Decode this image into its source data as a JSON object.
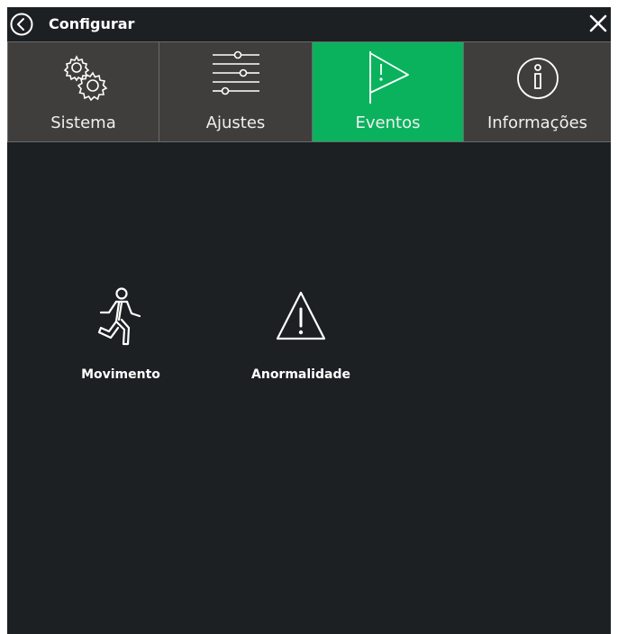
{
  "window": {
    "title": "Configurar",
    "back_icon": "chevron-left-circle-icon",
    "close_icon": "close-icon"
  },
  "tabs": [
    {
      "label": "Sistema",
      "icon": "gears-icon",
      "active": false
    },
    {
      "label": "Ajustes",
      "icon": "sliders-icon",
      "active": false
    },
    {
      "label": "Eventos",
      "icon": "flag-alert-icon",
      "active": true
    },
    {
      "label": "Informações",
      "icon": "info-icon",
      "active": false
    }
  ],
  "events": [
    {
      "label": "Movimento",
      "icon": "running-person-icon"
    },
    {
      "label": "Anormalidade",
      "icon": "warning-triangle-icon"
    }
  ],
  "colors": {
    "background": "#1c2022",
    "tab_inactive": "#403e3d",
    "tab_active": "#0bb25d",
    "text": "#ffffff"
  }
}
